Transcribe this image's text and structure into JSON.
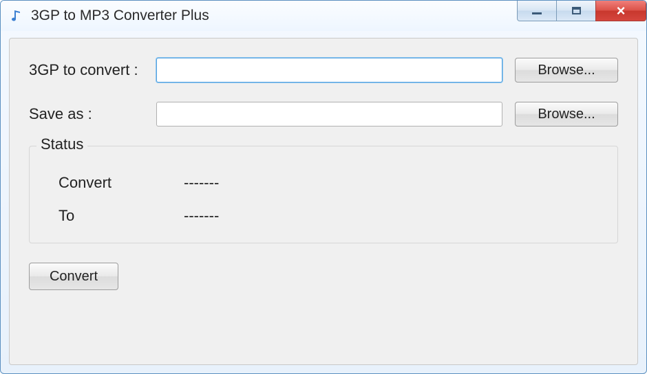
{
  "window": {
    "title": "3GP to MP3 Converter Plus"
  },
  "form": {
    "input_label": "3GP to convert :",
    "input_value": "",
    "save_label": "Save as :",
    "save_value": "",
    "browse_input_label": "Browse...",
    "browse_save_label": "Browse..."
  },
  "status": {
    "group_title": "Status",
    "convert_label": "Convert",
    "convert_value": "-------",
    "to_label": "To",
    "to_value": "-------"
  },
  "actions": {
    "convert_label": "Convert"
  }
}
